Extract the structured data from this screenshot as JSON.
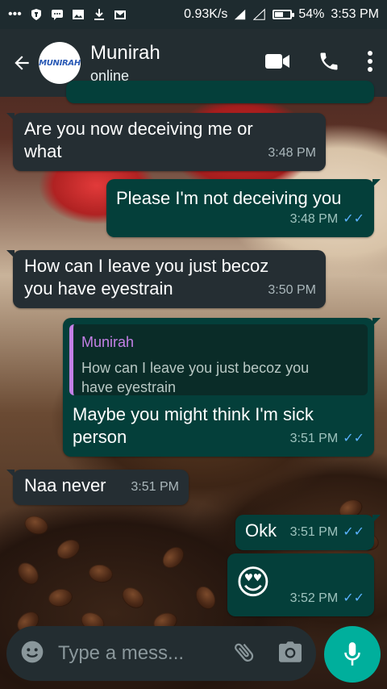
{
  "status_bar": {
    "speed": "0.93K/s",
    "battery": "54%",
    "battery_level": 0.54,
    "time": "3:53 PM"
  },
  "header": {
    "avatar_text": "MUNIRAH",
    "contact_name": "Munirah",
    "presence": "online"
  },
  "messages": [
    {
      "dir": "in",
      "text_lines": [
        "Are you now deceiving me or",
        "what"
      ],
      "time": "3:48 PM"
    },
    {
      "dir": "out",
      "text_lines": [
        "Please I'm not deceiving you"
      ],
      "time": "3:48 PM",
      "read": true
    },
    {
      "dir": "in",
      "text_lines": [
        "How can I leave you just becoz",
        "you have eyestrain"
      ],
      "time": "3:50 PM"
    },
    {
      "dir": "out",
      "quote": {
        "name": "Munirah",
        "text_lines": [
          "How can I leave you just becoz you",
          "have eyestrain"
        ]
      },
      "text_lines": [
        "Maybe you might think I'm sick",
        "person"
      ],
      "time": "3:51 PM",
      "read": true
    },
    {
      "dir": "in",
      "text_lines": [
        "Naa never"
      ],
      "time": "3:51 PM"
    },
    {
      "dir": "out",
      "text_lines": [
        "Okk"
      ],
      "time": "3:51 PM",
      "read": true
    },
    {
      "dir": "out",
      "emoji": "😍",
      "time": "3:52 PM",
      "read": true
    }
  ],
  "composer": {
    "placeholder": "Type a mess..."
  },
  "colors": {
    "incoming_bubble": "#252e33",
    "outgoing_bubble": "#043f3a",
    "read_tick": "#5ab2ff",
    "mic_button": "#00af9c",
    "quote_accent": "#c380e6"
  }
}
